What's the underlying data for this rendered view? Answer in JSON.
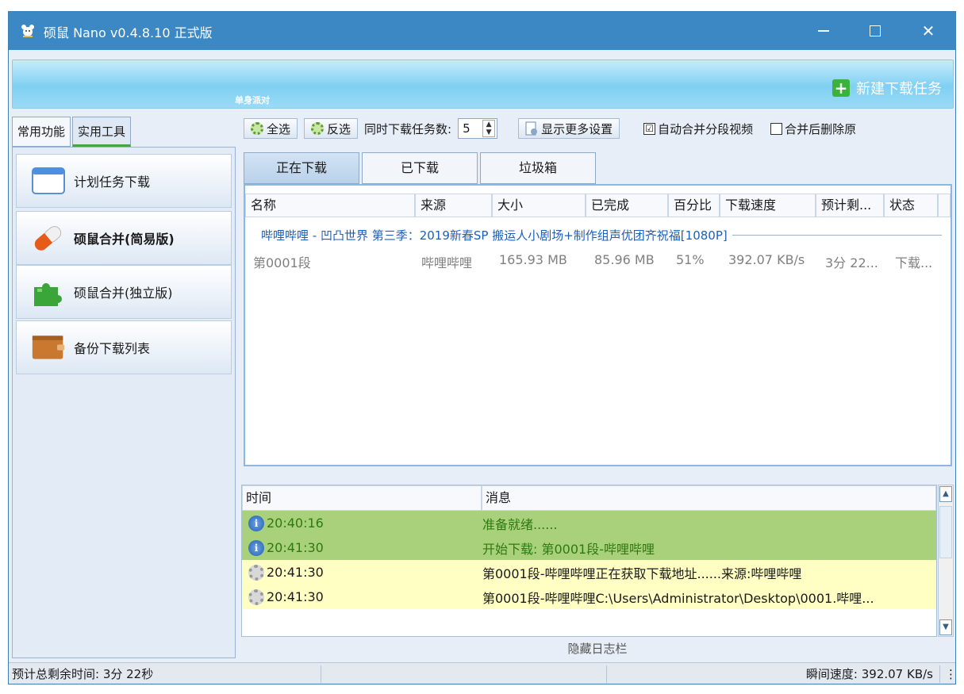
{
  "window": {
    "title": "硕鼠 Nano v0.4.8.10 正式版"
  },
  "banner": {
    "label": "单身派对",
    "new_task_label": "新建下载任务"
  },
  "left_tabs": [
    "常用功能",
    "实用工具"
  ],
  "sidebar": {
    "items": [
      {
        "label": "计划任务下载",
        "icon": "calendar-icon"
      },
      {
        "label": "硕鼠合并(简易版)",
        "icon": "pill-icon"
      },
      {
        "label": "硕鼠合并(独立版)",
        "icon": "puzzle-icon"
      },
      {
        "label": "备份下载列表",
        "icon": "wallet-icon"
      }
    ]
  },
  "toolbar": {
    "select_all": "全选",
    "invert": "反选",
    "concurrent_label": "同时下载任务数:",
    "concurrent_value": "5",
    "more_settings": "显示更多设置",
    "auto_merge_label": "自动合并分段视频",
    "auto_merge_checked": "☑",
    "delete_after_label": "合并后删除原"
  },
  "main_tabs": [
    "正在下载",
    "已下载",
    "垃圾箱"
  ],
  "download_table": {
    "columns": [
      "名称",
      "来源",
      "大小",
      "已完成",
      "百分比",
      "下载速度",
      "预计剩...",
      "状态"
    ],
    "group_title": "哔哩哔哩 - 凹凸世界 第三季：2019新春SP 搬运人小剧场+制作组声优团齐祝福[1080P]",
    "rows": [
      {
        "name": "第0001段",
        "source": "哔哩哔哩",
        "size": "165.93 MB",
        "done": "85.96 MB",
        "percent": "51%",
        "speed": "392.07 KB/s",
        "eta": "3分 22...",
        "status": "下载..."
      }
    ]
  },
  "log": {
    "columns": [
      "时间",
      "消息"
    ],
    "rows": [
      {
        "time": "20:40:16",
        "message": "准备就绪......",
        "type": "info"
      },
      {
        "time": "20:41:30",
        "message": "开始下载: 第0001段-哔哩哔哩",
        "type": "info"
      },
      {
        "time": "20:41:30",
        "message": "第0001段-哔哩哔哩正在获取下载地址......来源:哔哩哔哩",
        "type": "process"
      },
      {
        "time": "20:41:30",
        "message": "第0001段-哔哩哔哩C:\\Users\\Administrator\\Desktop\\0001.哔哩...",
        "type": "process"
      }
    ],
    "hide_label": "隐藏日志栏"
  },
  "statusbar": {
    "eta": "预计总剩余时间:  3分 22秒",
    "speed": "瞬间速度: 392.07 KB/s"
  }
}
